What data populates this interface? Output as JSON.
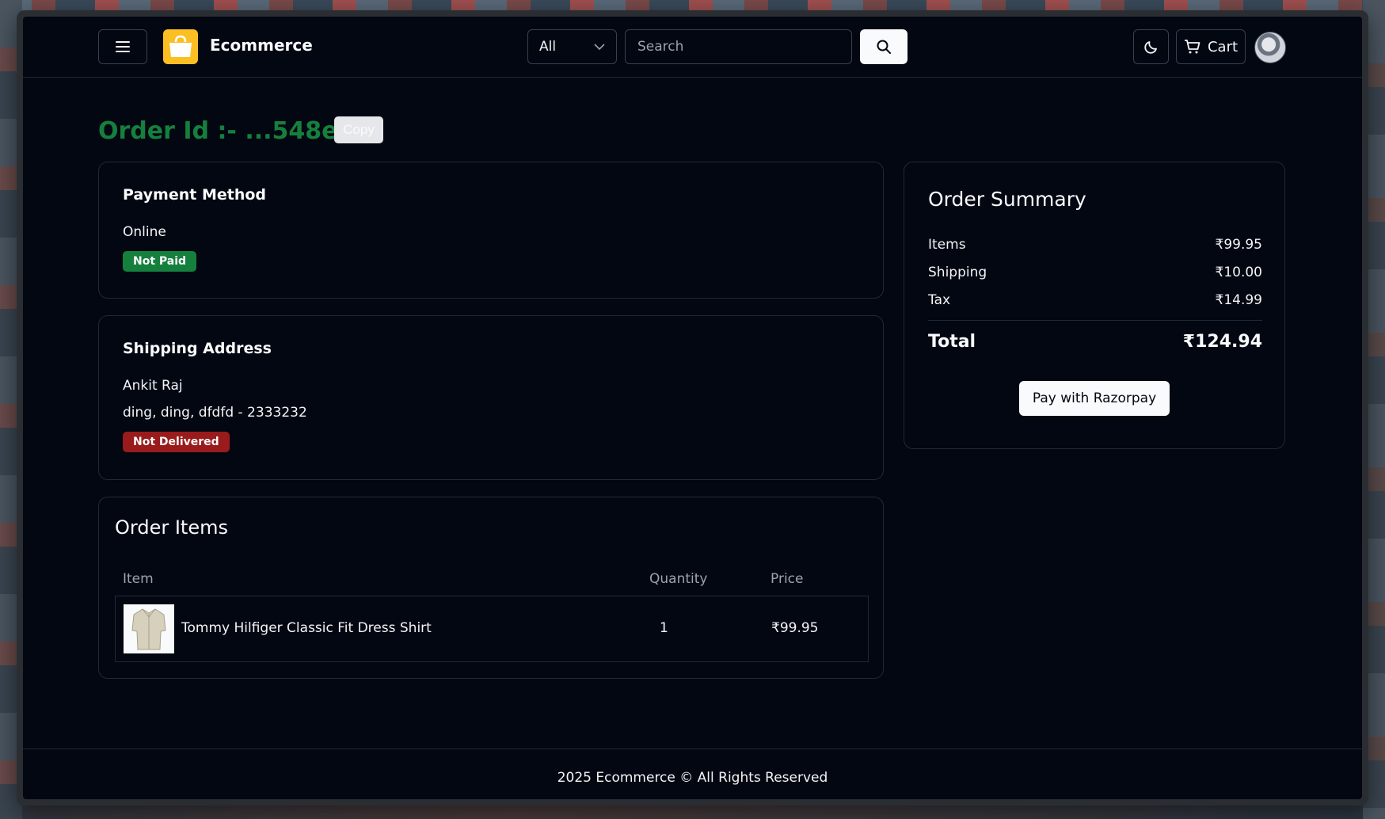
{
  "header": {
    "brand": "Ecommerce",
    "category": "All",
    "search_placeholder": "Search",
    "cart_label": "Cart"
  },
  "order": {
    "title": "Order Id :- ...548e10",
    "copy_label": "Copy"
  },
  "payment": {
    "heading": "Payment Method",
    "method": "Online",
    "status": "Not Paid"
  },
  "shipping": {
    "heading": "Shipping Address",
    "name": "Ankit Raj",
    "address": "ding, ding, dfdfd - 2333232",
    "status": "Not Delivered"
  },
  "items": {
    "heading": "Order Items",
    "columns": [
      "Item",
      "Quantity",
      "Price"
    ],
    "rows": [
      {
        "name": "Tommy Hilfiger Classic Fit Dress Shirt",
        "quantity": "1",
        "price": "₹99.95"
      }
    ]
  },
  "summary": {
    "heading": "Order Summary",
    "items_label": "Items",
    "items_value": "₹99.95",
    "shipping_label": "Shipping",
    "shipping_value": "₹10.00",
    "tax_label": "Tax",
    "tax_value": "₹14.99",
    "total_label": "Total",
    "total_value": "₹124.94",
    "pay_label": "Pay with Razorpay"
  },
  "footer": {
    "text": "2025 Ecommerce © All Rights Reserved"
  },
  "colors": {
    "background": "#030712",
    "success": "#15803d",
    "danger": "#991b1b",
    "logo": "#fbbf24"
  }
}
